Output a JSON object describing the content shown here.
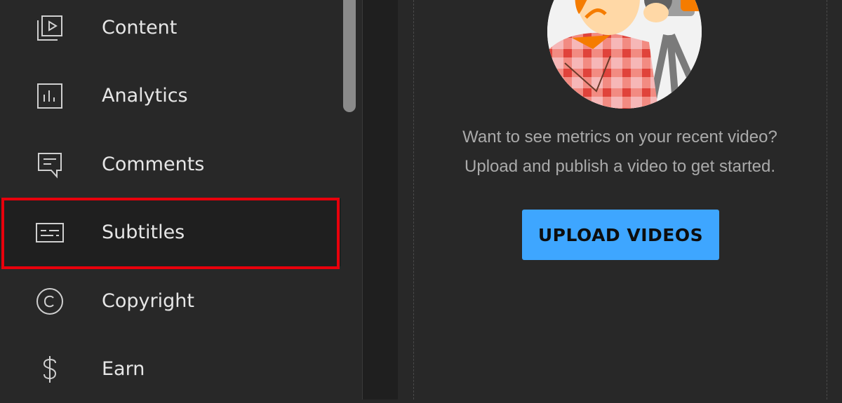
{
  "sidebar": {
    "items": [
      {
        "label": "Content",
        "icon": "video-library-icon",
        "active": false
      },
      {
        "label": "Analytics",
        "icon": "analytics-icon",
        "active": false
      },
      {
        "label": "Comments",
        "icon": "comments-icon",
        "active": false
      },
      {
        "label": "Subtitles",
        "icon": "subtitles-icon",
        "active": true
      },
      {
        "label": "Copyright",
        "icon": "copyright-icon",
        "active": false
      },
      {
        "label": "Earn",
        "icon": "dollar-icon",
        "active": false
      }
    ]
  },
  "main": {
    "message_line1": "Want to see metrics on your recent video?",
    "message_line2": "Upload and publish a video to get started.",
    "upload_button": "UPLOAD VIDEOS"
  },
  "colors": {
    "background": "#282828",
    "accent_button": "#3ea6ff",
    "highlight_border": "#e8000c",
    "text": "#e6e6e6"
  }
}
